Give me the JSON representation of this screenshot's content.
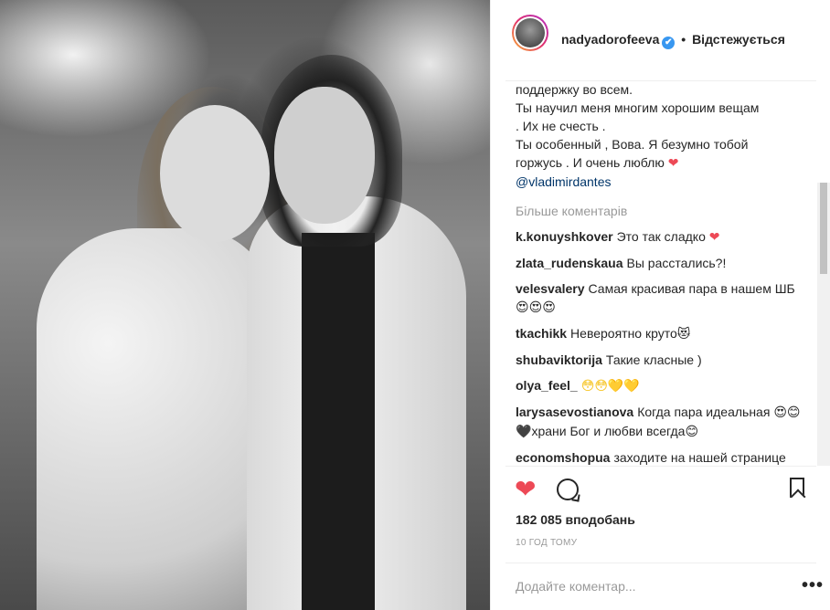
{
  "header": {
    "username": "nadyadorofeeva",
    "dot": "•",
    "follow_label": "Відстежується"
  },
  "caption": {
    "lines": [
      "поддержку во всем.",
      "Ты научил меня многим хорошим вещам",
      ". Их не счесть .",
      "Ты особенный , Вова. Я безумно тобой",
      "горжусь . И очень люблю"
    ],
    "mention": "@vladimirdantes"
  },
  "more_comments_label": "Більше коментарів",
  "comments": [
    {
      "user": "k.konuyshkover",
      "text": "Это так сладко",
      "emoji": "❤"
    },
    {
      "user": "zlata_rudenskaua",
      "text": "Вы расстались?!",
      "emoji": ""
    },
    {
      "user": "velesvalery",
      "text": "Самая красивая пара в нашем ШБ",
      "emoji": "😍😍😍"
    },
    {
      "user": "tkachikk",
      "text": "Невероятно круто",
      "emoji": "😻"
    },
    {
      "user": "shubaviktorija",
      "text": "Такие класные )",
      "emoji": ""
    },
    {
      "user": "olya_feel_",
      "text": "",
      "emoji": "😳😳💛💛"
    },
    {
      "user": "larysasevostianova",
      "text": "Когда пара идеальная",
      "emoji2_prefix": "😍😊🖤",
      "text2": "храни Бог и любви всегда",
      "emoji2_suffix": "😊"
    },
    {
      "user": "economshopua",
      "text": "заходите на нашей странице можно увидеть и купить",
      "emoji": ""
    }
  ],
  "likes_text": "182 085 вподобань",
  "time_text": "10 ГОД ТОМУ",
  "add_comment_placeholder": "Додайте коментар...",
  "more_options": "•••",
  "colors": {
    "like_red": "#ed4956",
    "verified_blue": "#3897f0",
    "link_blue": "#003569"
  },
  "icons": {
    "verified": "verified-badge-icon",
    "like": "heart-icon",
    "comment": "comment-icon",
    "save": "bookmark-icon"
  }
}
